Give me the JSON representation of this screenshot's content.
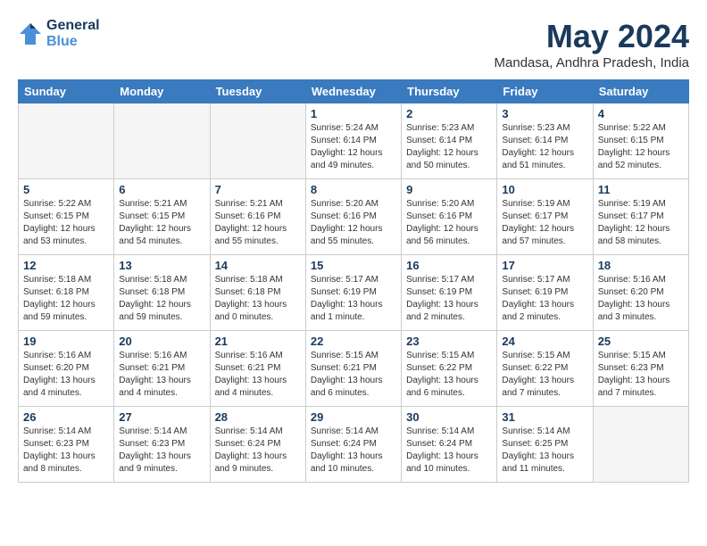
{
  "header": {
    "logo_line1": "General",
    "logo_line2": "Blue",
    "month": "May 2024",
    "location": "Mandasa, Andhra Pradesh, India"
  },
  "weekdays": [
    "Sunday",
    "Monday",
    "Tuesday",
    "Wednesday",
    "Thursday",
    "Friday",
    "Saturday"
  ],
  "weeks": [
    [
      {
        "day": "",
        "info": ""
      },
      {
        "day": "",
        "info": ""
      },
      {
        "day": "",
        "info": ""
      },
      {
        "day": "1",
        "info": "Sunrise: 5:24 AM\nSunset: 6:14 PM\nDaylight: 12 hours\nand 49 minutes."
      },
      {
        "day": "2",
        "info": "Sunrise: 5:23 AM\nSunset: 6:14 PM\nDaylight: 12 hours\nand 50 minutes."
      },
      {
        "day": "3",
        "info": "Sunrise: 5:23 AM\nSunset: 6:14 PM\nDaylight: 12 hours\nand 51 minutes."
      },
      {
        "day": "4",
        "info": "Sunrise: 5:22 AM\nSunset: 6:15 PM\nDaylight: 12 hours\nand 52 minutes."
      }
    ],
    [
      {
        "day": "5",
        "info": "Sunrise: 5:22 AM\nSunset: 6:15 PM\nDaylight: 12 hours\nand 53 minutes."
      },
      {
        "day": "6",
        "info": "Sunrise: 5:21 AM\nSunset: 6:15 PM\nDaylight: 12 hours\nand 54 minutes."
      },
      {
        "day": "7",
        "info": "Sunrise: 5:21 AM\nSunset: 6:16 PM\nDaylight: 12 hours\nand 55 minutes."
      },
      {
        "day": "8",
        "info": "Sunrise: 5:20 AM\nSunset: 6:16 PM\nDaylight: 12 hours\nand 55 minutes."
      },
      {
        "day": "9",
        "info": "Sunrise: 5:20 AM\nSunset: 6:16 PM\nDaylight: 12 hours\nand 56 minutes."
      },
      {
        "day": "10",
        "info": "Sunrise: 5:19 AM\nSunset: 6:17 PM\nDaylight: 12 hours\nand 57 minutes."
      },
      {
        "day": "11",
        "info": "Sunrise: 5:19 AM\nSunset: 6:17 PM\nDaylight: 12 hours\nand 58 minutes."
      }
    ],
    [
      {
        "day": "12",
        "info": "Sunrise: 5:18 AM\nSunset: 6:18 PM\nDaylight: 12 hours\nand 59 minutes."
      },
      {
        "day": "13",
        "info": "Sunrise: 5:18 AM\nSunset: 6:18 PM\nDaylight: 12 hours\nand 59 minutes."
      },
      {
        "day": "14",
        "info": "Sunrise: 5:18 AM\nSunset: 6:18 PM\nDaylight: 13 hours\nand 0 minutes."
      },
      {
        "day": "15",
        "info": "Sunrise: 5:17 AM\nSunset: 6:19 PM\nDaylight: 13 hours\nand 1 minute."
      },
      {
        "day": "16",
        "info": "Sunrise: 5:17 AM\nSunset: 6:19 PM\nDaylight: 13 hours\nand 2 minutes."
      },
      {
        "day": "17",
        "info": "Sunrise: 5:17 AM\nSunset: 6:19 PM\nDaylight: 13 hours\nand 2 minutes."
      },
      {
        "day": "18",
        "info": "Sunrise: 5:16 AM\nSunset: 6:20 PM\nDaylight: 13 hours\nand 3 minutes."
      }
    ],
    [
      {
        "day": "19",
        "info": "Sunrise: 5:16 AM\nSunset: 6:20 PM\nDaylight: 13 hours\nand 4 minutes."
      },
      {
        "day": "20",
        "info": "Sunrise: 5:16 AM\nSunset: 6:21 PM\nDaylight: 13 hours\nand 4 minutes."
      },
      {
        "day": "21",
        "info": "Sunrise: 5:16 AM\nSunset: 6:21 PM\nDaylight: 13 hours\nand 4 minutes."
      },
      {
        "day": "22",
        "info": "Sunrise: 5:15 AM\nSunset: 6:21 PM\nDaylight: 13 hours\nand 6 minutes."
      },
      {
        "day": "23",
        "info": "Sunrise: 5:15 AM\nSunset: 6:22 PM\nDaylight: 13 hours\nand 6 minutes."
      },
      {
        "day": "24",
        "info": "Sunrise: 5:15 AM\nSunset: 6:22 PM\nDaylight: 13 hours\nand 7 minutes."
      },
      {
        "day": "25",
        "info": "Sunrise: 5:15 AM\nSunset: 6:23 PM\nDaylight: 13 hours\nand 7 minutes."
      }
    ],
    [
      {
        "day": "26",
        "info": "Sunrise: 5:14 AM\nSunset: 6:23 PM\nDaylight: 13 hours\nand 8 minutes."
      },
      {
        "day": "27",
        "info": "Sunrise: 5:14 AM\nSunset: 6:23 PM\nDaylight: 13 hours\nand 9 minutes."
      },
      {
        "day": "28",
        "info": "Sunrise: 5:14 AM\nSunset: 6:24 PM\nDaylight: 13 hours\nand 9 minutes."
      },
      {
        "day": "29",
        "info": "Sunrise: 5:14 AM\nSunset: 6:24 PM\nDaylight: 13 hours\nand 10 minutes."
      },
      {
        "day": "30",
        "info": "Sunrise: 5:14 AM\nSunset: 6:24 PM\nDaylight: 13 hours\nand 10 minutes."
      },
      {
        "day": "31",
        "info": "Sunrise: 5:14 AM\nSunset: 6:25 PM\nDaylight: 13 hours\nand 11 minutes."
      },
      {
        "day": "",
        "info": ""
      }
    ]
  ]
}
